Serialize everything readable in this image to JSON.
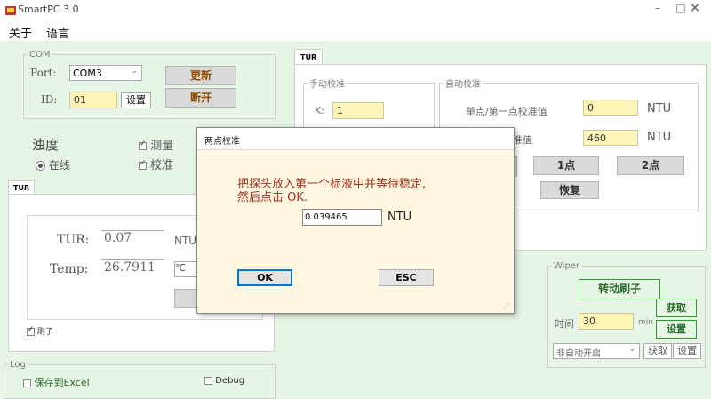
{
  "window": {
    "title": "SmartPC 3.0"
  },
  "menu": {
    "about": "关于",
    "language": "语言"
  },
  "com": {
    "legend": "COM",
    "port_label": "Port:",
    "port_value": "COM3",
    "id_label": "ID:",
    "id_value": "01",
    "set_label": "设置",
    "refresh_label": "更新",
    "disconnect_label": "断开"
  },
  "turbidity": {
    "title": "浊度",
    "online_label": "在线",
    "measure_label": "测量",
    "calibrate_label": "校准"
  },
  "tur_left": {
    "tab": "TUR",
    "tur_label": "TUR:",
    "tur_value": "0.07",
    "tur_unit": "NTU",
    "temp_label": "Temp:",
    "temp_value": "26.7911",
    "temp_unit": "℃",
    "brush_label": "刷子"
  },
  "tur_right": {
    "tab": "TUR",
    "manual_legend": "手动校准",
    "k_label": "K:",
    "k_value": "1",
    "auto_legend": "自动校准",
    "point1_label": "单点/第一点校准值",
    "point1_value": "0",
    "point1_unit": "NTU",
    "point2_label": "准值",
    "point2_value": "460",
    "point2_unit": "NTU",
    "one_point_label": "1点",
    "two_point_label": "2点",
    "restore_label": "恢复"
  },
  "wiper": {
    "legend": "Wiper",
    "rotate_label": "转动刷子",
    "time_label": "时间",
    "time_value": "30",
    "time_unit": "min",
    "get_label": "获取",
    "set_label": "设置",
    "auto_select": "非自动开启",
    "get2_label": "获取",
    "set2_label": "设置"
  },
  "log": {
    "legend": "Log",
    "excel_label": "保存到Excel",
    "debug_label": "Debug"
  },
  "dialog": {
    "title": "两点校准",
    "message_line1": "把探头放入第一个标液中并等待稳定,",
    "message_line2": "然后点击 OK.",
    "value": "0.039465",
    "unit": "NTU",
    "ok_label": "OK",
    "esc_label": "ESC"
  },
  "colors": {
    "button_text": "#8a4a00",
    "message_text": "#a0301c",
    "field_yellow": "#fff5b8",
    "background": "#e6f5e6"
  }
}
